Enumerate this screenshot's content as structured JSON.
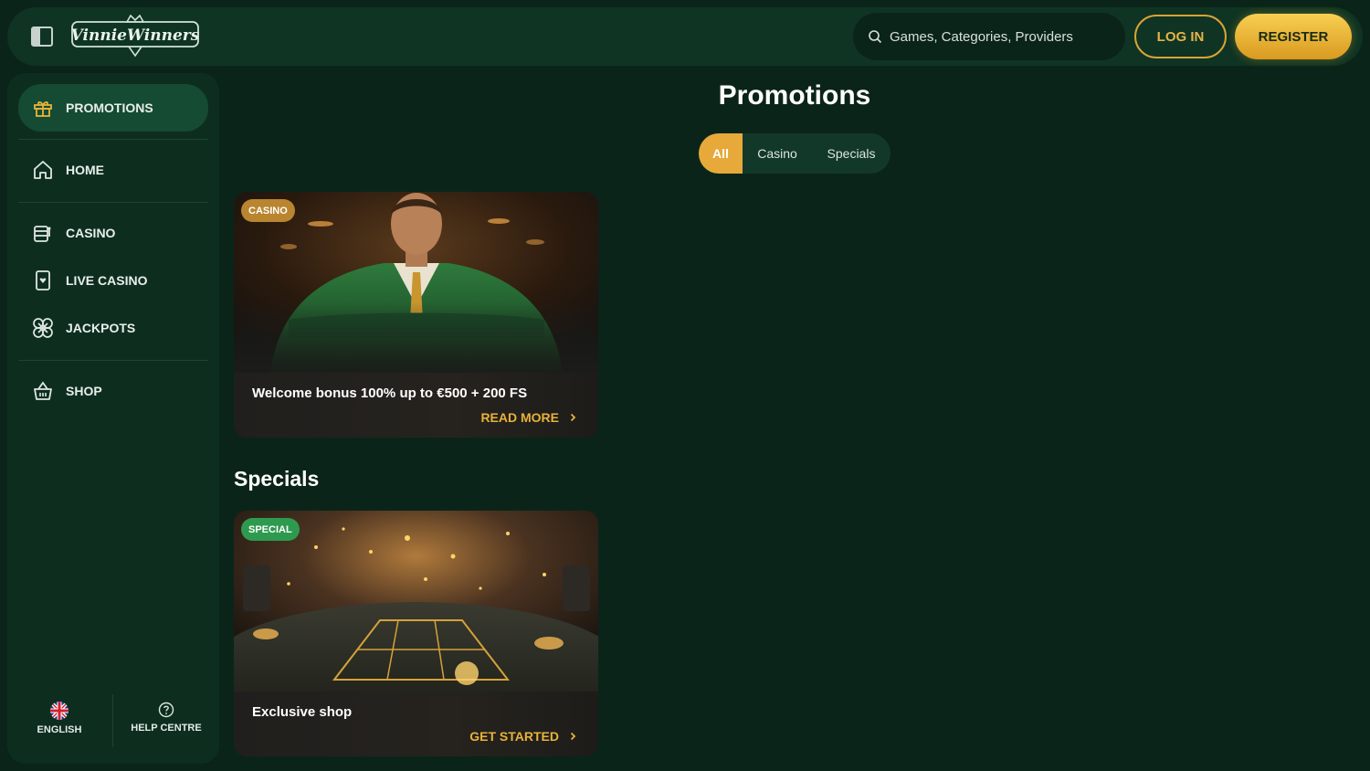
{
  "header": {
    "logo_text": "VinnieWinners",
    "search_placeholder": "Games, Categories, Providers",
    "login_label": "LOG IN",
    "register_label": "REGISTER"
  },
  "sidebar": {
    "items": [
      {
        "label": "PROMOTIONS",
        "icon": "gift-icon",
        "active": true
      },
      {
        "label": "HOME",
        "icon": "home-icon"
      },
      {
        "label": "CASINO",
        "icon": "slot-machine-icon"
      },
      {
        "label": "LIVE CASINO",
        "icon": "playing-card-icon"
      },
      {
        "label": "JACKPOTS",
        "icon": "clover-icon"
      },
      {
        "label": "SHOP",
        "icon": "basket-icon"
      }
    ],
    "footer": {
      "language_label": "ENGLISH",
      "help_label": "HELP CENTRE"
    }
  },
  "main": {
    "title": "Promotions",
    "tabs": [
      {
        "label": "All",
        "active": true
      },
      {
        "label": "Casino"
      },
      {
        "label": "Specials"
      }
    ],
    "promotions": [
      {
        "badge": "CASINO",
        "title": "Welcome bonus 100% up to €500 + 200 FS",
        "link": "READ MORE"
      }
    ],
    "specials_heading": "Specials",
    "specials": [
      {
        "badge": "SPECIAL",
        "title": "Exclusive shop",
        "link": "GET STARTED"
      }
    ]
  },
  "colors": {
    "background": "#0b2419",
    "accent_gold": "#e8b23a",
    "casino_badge": "#b9852f",
    "special_badge": "#2e9a4f"
  }
}
